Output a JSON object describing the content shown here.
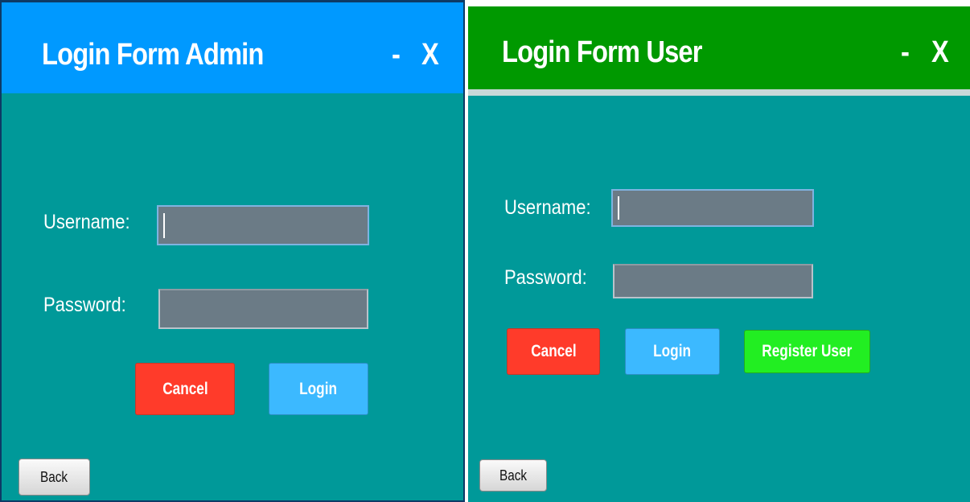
{
  "admin_form": {
    "title": "Login Form Admin",
    "minimize_label": "-",
    "close_label": "X",
    "title_color": "#0099ff",
    "username_label": "Username:",
    "password_label": "Password:",
    "username_value": "",
    "password_value": "",
    "cancel_label": "Cancel",
    "login_label": "Login",
    "back_label": "Back"
  },
  "user_form": {
    "title": "Login Form User",
    "minimize_label": "-",
    "close_label": "X",
    "title_color": "#009900",
    "username_label": "Username:",
    "password_label": "Password:",
    "username_value": "",
    "password_value": "",
    "cancel_label": "Cancel",
    "login_label": "Login",
    "register_label": "Register User",
    "back_label": "Back"
  },
  "colors": {
    "body_background": "#009999",
    "cancel": "#ff3b2a",
    "login": "#3cb9ff",
    "register": "#22ee22",
    "field": "#6b7b86"
  }
}
